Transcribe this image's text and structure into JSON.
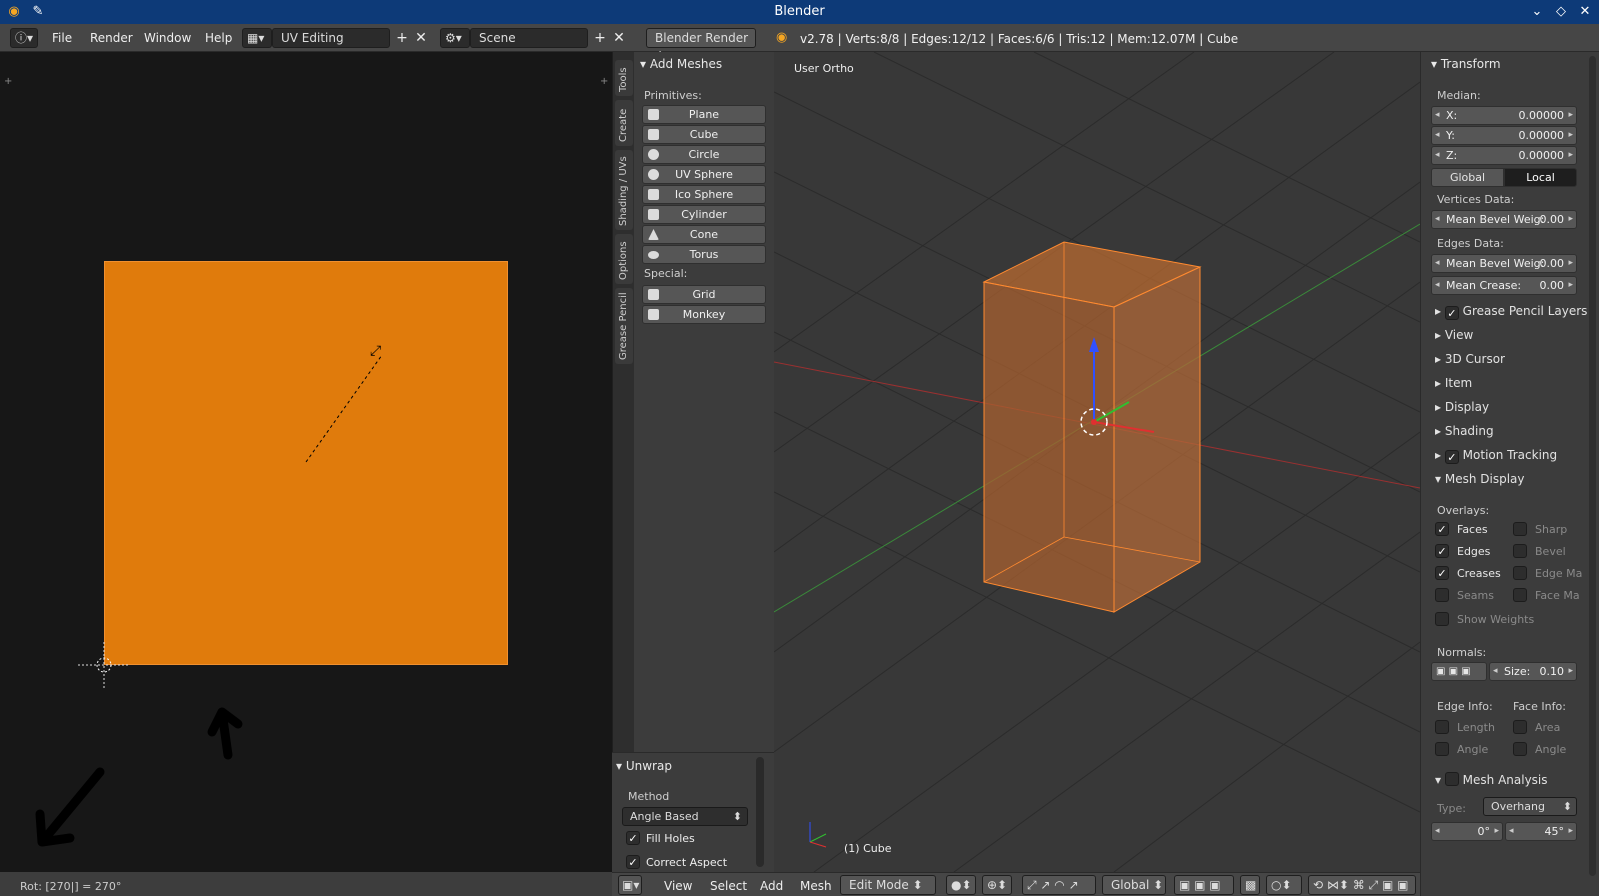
{
  "window": {
    "title": "Blender"
  },
  "infobar": {
    "menus": [
      "File",
      "Render",
      "Window",
      "Help"
    ],
    "screen_layout": "UV Editing",
    "scene": "Scene",
    "engine": "Blender Render",
    "stats": "v2.78 | Verts:8/8 | Edges:12/12 | Faces:6/6 | Tris:12 | Mem:12.07M | Cube"
  },
  "tool_tabs": [
    "Tools",
    "Create",
    "Shading / UVs",
    "Options",
    "Grease Pencil"
  ],
  "tool_shelf": {
    "panel_title": "Add Meshes",
    "primitives_label": "Primitives:",
    "primitives": [
      "Plane",
      "Cube",
      "Circle",
      "UV Sphere",
      "Ico Sphere",
      "Cylinder",
      "Cone",
      "Torus"
    ],
    "special_label": "Special:",
    "special": [
      "Grid",
      "Monkey"
    ]
  },
  "unwrap": {
    "title": "Unwrap",
    "method_label": "Method",
    "method_value": "Angle Based",
    "fill_holes": "Fill Holes",
    "correct_aspect": "Correct Aspect"
  },
  "uv_editor": {
    "status": "Rot: [270|] = 270°"
  },
  "viewport": {
    "view_name": "User Ortho",
    "object_label": "(1) Cube",
    "menus": [
      "View",
      "Select",
      "Add",
      "Mesh"
    ],
    "mode": "Edit Mode",
    "orientation": "Global"
  },
  "properties": {
    "transform_title": "Transform",
    "median_label": "Median:",
    "x": {
      "label": "X:",
      "value": "0.00000"
    },
    "y": {
      "label": "Y:",
      "value": "0.00000"
    },
    "z": {
      "label": "Z:",
      "value": "0.00000"
    },
    "global_label": "Global",
    "local_label": "Local",
    "vertices_data_label": "Vertices Data:",
    "vertex_bevel": {
      "label": "Mean Bevel Weig:",
      "value": "0.00"
    },
    "edges_data_label": "Edges Data:",
    "edge_bevel": {
      "label": "Mean Bevel Weig:",
      "value": "0.00"
    },
    "edge_crease": {
      "label": "Mean Crease:",
      "value": "0.00"
    },
    "sections": [
      "Grease Pencil Layers",
      "View",
      "3D Cursor",
      "Item",
      "Display",
      "Shading",
      "Motion Tracking",
      "Mesh Display"
    ],
    "overlays_label": "Overlays:",
    "overlays_left": [
      "Faces",
      "Edges",
      "Creases",
      "Seams",
      "Show Weights"
    ],
    "overlays_right": [
      "Sharp",
      "Bevel",
      "Edge Ma",
      "Face Ma"
    ],
    "normals_label": "Normals:",
    "normals_size": {
      "label": "Size:",
      "value": "0.10"
    },
    "edge_info_label": "Edge Info:",
    "face_info_label": "Face Info:",
    "edge_info": [
      "Length",
      "Angle"
    ],
    "face_info": [
      "Area",
      "Angle"
    ],
    "mesh_analysis": "Mesh Analysis",
    "type_label": "Type:",
    "type_value": "Overhang",
    "range_min": "0°",
    "range_max": "45°"
  },
  "colors": {
    "accent_orange": "#e07b0c",
    "title_blue": "#0d3a78",
    "panel_bg": "#3c3c3c"
  }
}
